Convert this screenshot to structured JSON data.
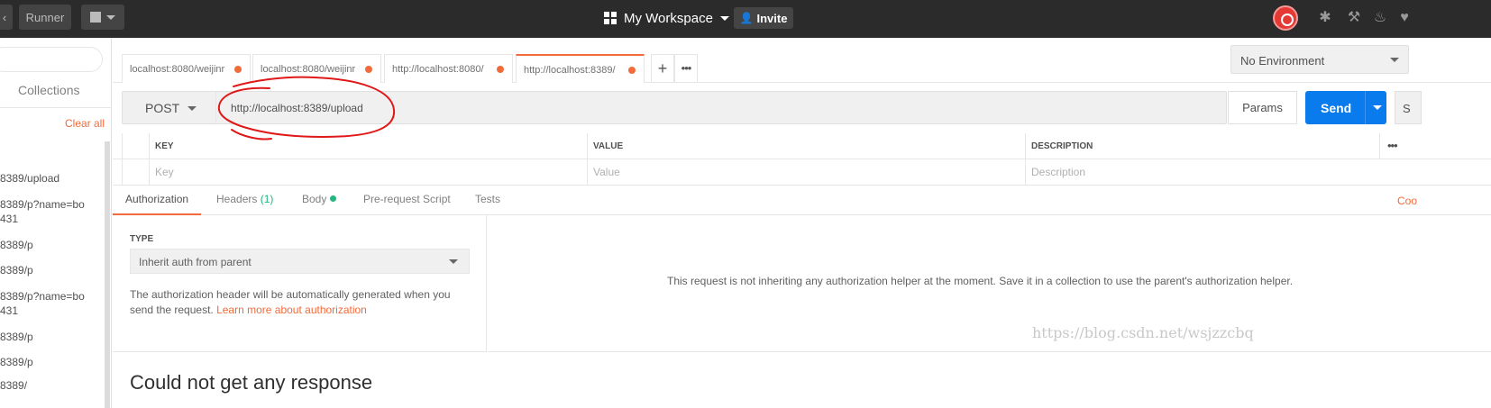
{
  "topbar": {
    "runner_label": "Runner",
    "workspace_label": "My Workspace",
    "invite_label": "Invite"
  },
  "sidebar": {
    "collections_label": "Collections",
    "clear_all_label": "Clear all",
    "history": [
      "8389/upload",
      "8389/p?name=bo",
      "431",
      "8389/p",
      "8389/p",
      "8389/p?name=bo",
      "431",
      "8389/p",
      "8389/p",
      "8389/"
    ]
  },
  "tabs": [
    {
      "label": "localhost:8080/weijinr"
    },
    {
      "label": "localhost:8080/weijinr"
    },
    {
      "label": "http://localhost:8080/"
    },
    {
      "label": "http://localhost:8389/"
    }
  ],
  "environment": {
    "selected": "No Environment"
  },
  "request": {
    "method": "POST",
    "url": "http://localhost:8389/upload",
    "params_label": "Params",
    "send_label": "Send",
    "save_label": "S"
  },
  "params_table": {
    "headers": [
      "KEY",
      "VALUE",
      "DESCRIPTION"
    ],
    "placeholders": [
      "Key",
      "Value",
      "Description"
    ]
  },
  "subtabs": {
    "authorization": "Authorization",
    "headers": "Headers",
    "headers_count": "(1)",
    "body": "Body",
    "prerequest": "Pre-request Script",
    "tests": "Tests",
    "cookies": "Coo"
  },
  "auth": {
    "type_label": "TYPE",
    "type_value": "Inherit auth from parent",
    "description": "The authorization header will be automatically generated when you send the request. ",
    "learn_more": "Learn more about authorization",
    "info": "This request is not inheriting any authorization helper at the moment. Save it in a collection to use the parent's authorization helper."
  },
  "response": {
    "title": "Could not get any response"
  },
  "watermark": "https://blog.csdn.net/wsjzzcbq",
  "colors": {
    "accent": "#f26b3a",
    "send": "#097bed",
    "topbar": "#2b2b2b",
    "annotation": "#e01818",
    "success": "#26b47f"
  }
}
